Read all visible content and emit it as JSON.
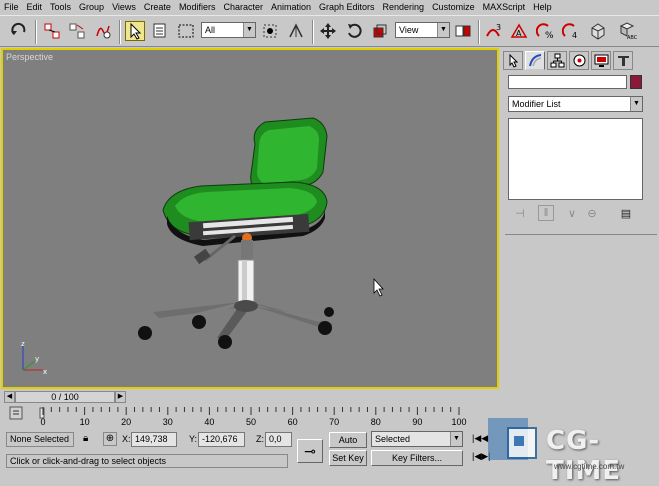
{
  "menu": [
    "File",
    "Edit",
    "Tools",
    "Group",
    "Views",
    "Create",
    "Modifiers",
    "Character",
    "Animation",
    "Graph Editors",
    "Rendering",
    "Customize",
    "MAXScript",
    "Help"
  ],
  "toolbar": {
    "selection_filter": "All",
    "ref_coord": "View",
    "icons": [
      "undo-icon",
      "select-and-link-icon",
      "unlink-icon",
      "bind-space-warp-icon",
      "select-object-icon",
      "select-by-name-icon",
      "rect-selection-icon",
      "use-pivot-center-icon",
      "snap-icon",
      "select-and-move-icon",
      "select-and-rotate-icon",
      "select-and-scale-icon",
      "mirror-icon",
      "align-icon",
      "spinner-snap-icon",
      "angle-snap-icon",
      "render-scene-icon",
      "quick-render-icon"
    ]
  },
  "viewport": {
    "label": "Perspective"
  },
  "command_panel": {
    "tabs": [
      "create-tab-icon",
      "modify-tab-icon",
      "hierarchy-tab-icon",
      "motion-tab-icon",
      "display-tab-icon",
      "utilities-tab-icon"
    ],
    "modifier_list": "Modifier List",
    "swatch_color": "#8b1a3a"
  },
  "time": {
    "slider": "0 / 100",
    "ticks": [
      "0",
      "10",
      "20",
      "30",
      "40",
      "50",
      "60",
      "70",
      "80",
      "90",
      "100"
    ]
  },
  "status": {
    "selection": "None Selected",
    "x_label": "X:",
    "x_value": "149,738",
    "y_label": "Y:",
    "y_value": "-120,676",
    "z_label": "Z:",
    "z_value": "0,0",
    "autokey": "Auto Key",
    "selected_dropdown": "Selected",
    "setkey": "Set Key",
    "keyfilters": "Key Filters...",
    "prompt": "Click or click-and-drag to select objects"
  },
  "watermark": {
    "brand": "CG-TIME",
    "url": "www.cgtime.com.tw"
  }
}
